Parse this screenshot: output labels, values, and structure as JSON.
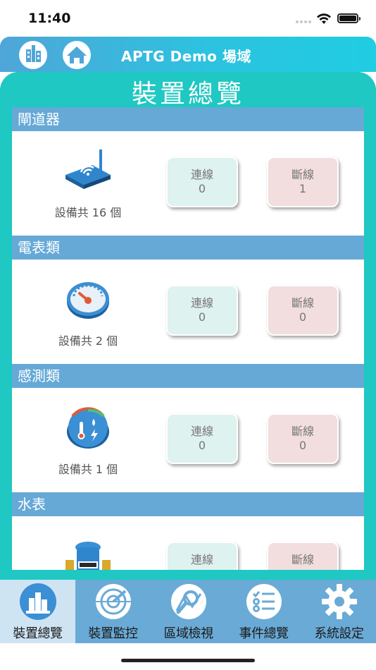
{
  "status_bar": {
    "time": "11:40"
  },
  "header": {
    "title": "APTG Demo 場域",
    "buttons": [
      {
        "name": "building-icon"
      },
      {
        "name": "home-icon"
      }
    ]
  },
  "panel": {
    "title": "裝置總覽"
  },
  "sections": [
    {
      "title": "閘道器",
      "icon": "router-icon",
      "count_text": "設備共 16 個",
      "connected_label": "連線",
      "connected_value": "0",
      "disconnected_label": "斷線",
      "disconnected_value": "1"
    },
    {
      "title": "電表類",
      "icon": "meter-gauge-icon",
      "count_text": "設備共 2 個",
      "connected_label": "連線",
      "connected_value": "0",
      "disconnected_label": "斷線",
      "disconnected_value": "0"
    },
    {
      "title": "感測類",
      "icon": "sensor-icon",
      "count_text": "設備共 1 個",
      "connected_label": "連線",
      "connected_value": "0",
      "disconnected_label": "斷線",
      "disconnected_value": "0"
    },
    {
      "title": "水表",
      "icon": "water-meter-icon",
      "count_text": "",
      "connected_label": "連線",
      "connected_value": "",
      "disconnected_label": "斷線",
      "disconnected_value": ""
    }
  ],
  "tabs": [
    {
      "label": "裝置總覽",
      "icon": "device-overview-icon",
      "active": true
    },
    {
      "label": "裝置監控",
      "icon": "radar-icon",
      "active": false
    },
    {
      "label": "區域檢視",
      "icon": "map-search-icon",
      "active": false
    },
    {
      "label": "事件總覽",
      "icon": "checklist-icon",
      "active": false
    },
    {
      "label": "系統設定",
      "icon": "gear-icon",
      "active": false
    }
  ],
  "colors": {
    "header": "#2cc2e0",
    "panel": "#1fc8c2",
    "section_head": "#66a9d6",
    "tabbar": "#6aaad6",
    "connected": "#def2ef",
    "disconnected": "#f2dedf"
  }
}
